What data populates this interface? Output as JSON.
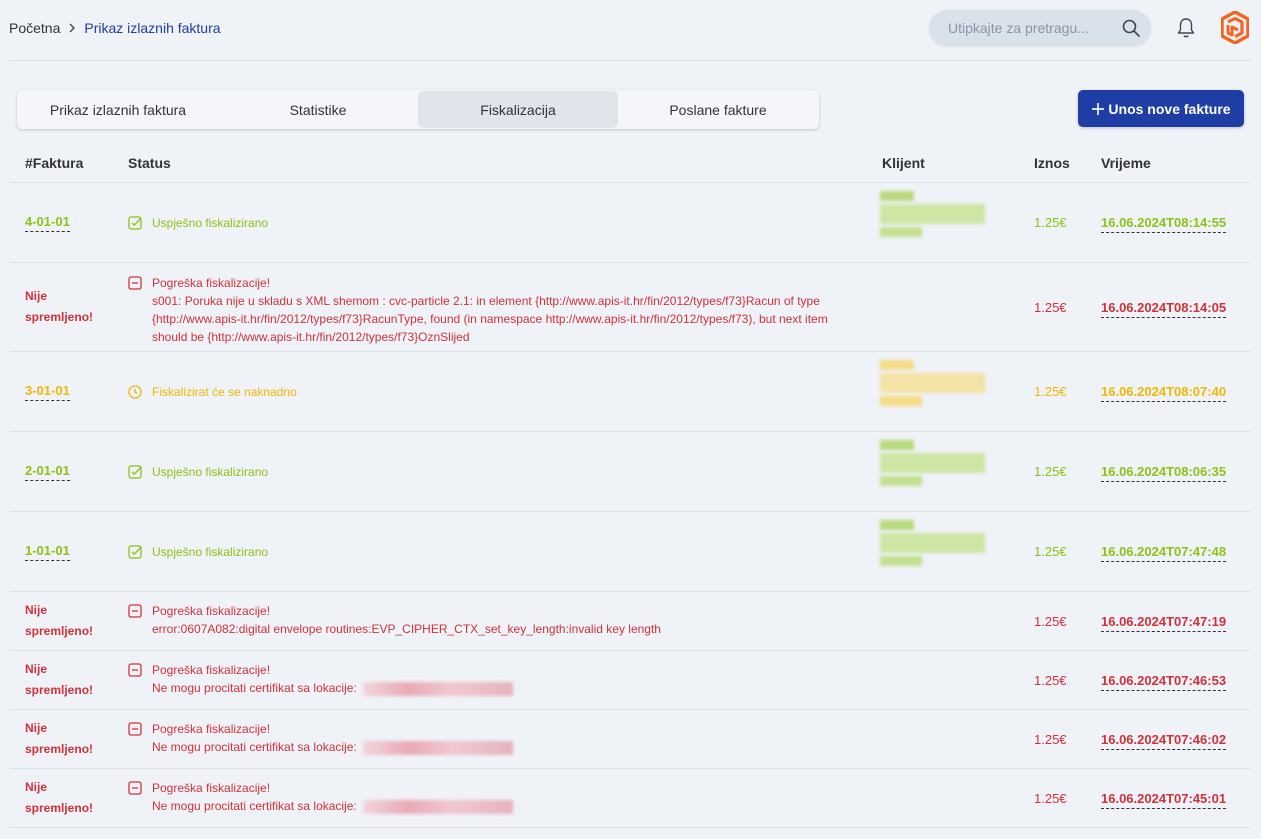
{
  "breadcrumb": {
    "home": "Početna",
    "current": "Prikaz izlaznih faktura"
  },
  "search": {
    "placeholder": "Utipkajte za pretragu..."
  },
  "tabs": [
    "Prikaz izlaznih faktura",
    "Statistike",
    "Fiskalizacija",
    "Poslane fakture"
  ],
  "active_tab": "Fiskalizacija",
  "new_invoice_button": "Unos nove fakture",
  "colors": {
    "brand": "#1e3da5",
    "success": "#8cc317",
    "error": "#d0323b",
    "pending": "#f2b705",
    "logo": "#f26522"
  },
  "table": {
    "headers": {
      "faktura": "#Faktura",
      "status": "Status",
      "klijent": "Klijent",
      "iznos": "Iznos",
      "vrijeme": "Vrijeme"
    },
    "rows": [
      {
        "faktura": "4-01-01",
        "status": "Uspješno fiskalizirano",
        "status_icon": "check-square-icon",
        "iznos": "1.25€",
        "vrijeme": "16.06.2024T08:14:55",
        "state": "success"
      },
      {
        "faktura": "Nije spremljeno!",
        "status": "Pogreška fiskalizacije!",
        "status_icon": "minus-square-icon",
        "message": [
          "s001: Poruka nije u skladu s XML shemom : cvc-particle 2.1: in element {http://www.apis-it.hr/fin/2012/types/f73}Racun of type",
          "{http://www.apis-it.hr/fin/2012/types/f73}RacunType, found (in namespace http://www.apis-it.hr/fin/2012/types/f73), but next item",
          "should be {http://www.apis-it.hr/fin/2012/types/f73}OznSlijed"
        ],
        "iznos": "1.25€",
        "vrijeme": "16.06.2024T08:14:05",
        "state": "error"
      },
      {
        "faktura": "3-01-01",
        "status": "Fiskalizirat će se naknadno",
        "status_icon": "clock-icon",
        "iznos": "1.25€",
        "vrijeme": "16.06.2024T08:07:40",
        "state": "pending"
      },
      {
        "faktura": "2-01-01",
        "status": "Uspješno fiskalizirano",
        "status_icon": "check-square-icon",
        "iznos": "1.25€",
        "vrijeme": "16.06.2024T08:06:35",
        "state": "success"
      },
      {
        "faktura": "1-01-01",
        "status": "Uspješno fiskalizirano",
        "status_icon": "check-square-icon",
        "iznos": "1.25€",
        "vrijeme": "16.06.2024T07:47:48",
        "state": "success"
      },
      {
        "faktura": "Nije spremljeno!",
        "status": "Pogreška fiskalizacije!",
        "status_icon": "minus-square-icon",
        "message": [
          "error:0607A082:digital envelope routines:EVP_CIPHER_CTX_set_key_length:invalid key length"
        ],
        "iznos": "1.25€",
        "vrijeme": "16.06.2024T07:47:19",
        "state": "error"
      },
      {
        "faktura": "Nije spremljeno!",
        "status": "Pogreška fiskalizacije!",
        "status_icon": "minus-square-icon",
        "message": [
          "Ne mogu procitati certifikat sa lokacije:"
        ],
        "iznos": "1.25€",
        "vrijeme": "16.06.2024T07:46:53",
        "state": "error"
      },
      {
        "faktura": "Nije spremljeno!",
        "status": "Pogreška fiskalizacije!",
        "status_icon": "minus-square-icon",
        "message": [
          "Ne mogu procitati certifikat sa lokacije:"
        ],
        "iznos": "1.25€",
        "vrijeme": "16.06.2024T07:46:02",
        "state": "error"
      },
      {
        "faktura": "Nije spremljeno!",
        "status": "Pogreška fiskalizacije!",
        "status_icon": "minus-square-icon",
        "message": [
          "Ne mogu procitati certifikat sa lokacije:"
        ],
        "iznos": "1.25€",
        "vrijeme": "16.06.2024T07:45:01",
        "state": "error"
      }
    ]
  }
}
